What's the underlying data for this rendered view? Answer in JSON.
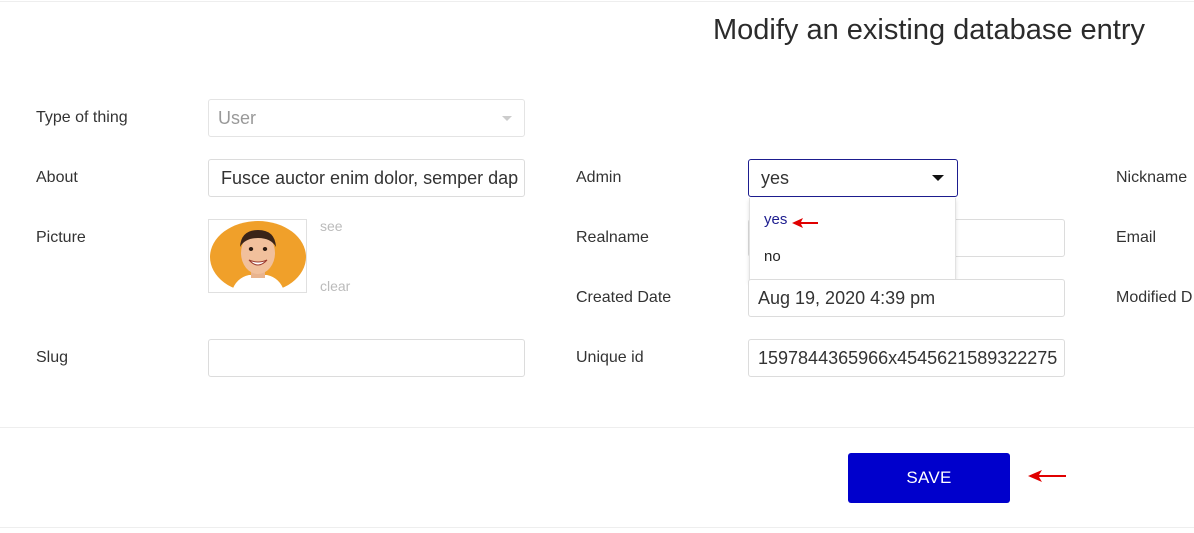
{
  "header": {
    "title": "Modify an existing database entry"
  },
  "form": {
    "type_of_thing": {
      "label": "Type of thing",
      "value": "User"
    },
    "about": {
      "label": "About",
      "value": "Fusce auctor enim dolor, semper dap"
    },
    "picture": {
      "label": "Picture",
      "see_label": "see",
      "clear_label": "clear"
    },
    "slug": {
      "label": "Slug",
      "value": ""
    },
    "admin": {
      "label": "Admin",
      "value": "yes",
      "options": [
        "yes",
        "no"
      ]
    },
    "realname": {
      "label": "Realname",
      "value": ""
    },
    "created_date": {
      "label": "Created Date",
      "value": "Aug 19, 2020 4:39 pm"
    },
    "unique_id": {
      "label": "Unique id",
      "value": "1597844365966x4545621589322275"
    },
    "nickname": {
      "label": "Nickname"
    },
    "email": {
      "label": "Email"
    },
    "modified_date": {
      "label": "Modified D"
    }
  },
  "actions": {
    "save_label": "SAVE"
  },
  "colors": {
    "accent": "#0000cc",
    "annotation_arrow": "#e00000",
    "focus_border": "#1d1d8f"
  },
  "icons": {
    "select_caret": "chevron-down-icon",
    "annotation": "red-arrow-icon"
  }
}
